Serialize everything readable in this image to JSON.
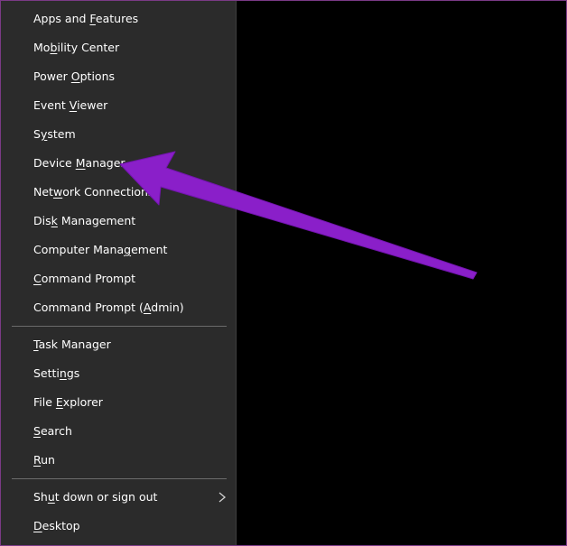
{
  "menu": {
    "group1": [
      {
        "pre": "Apps and ",
        "key": "F",
        "post": "eatures"
      },
      {
        "pre": "Mo",
        "key": "b",
        "post": "ility Center"
      },
      {
        "pre": "Power ",
        "key": "O",
        "post": "ptions"
      },
      {
        "pre": "Event ",
        "key": "V",
        "post": "iewer"
      },
      {
        "pre": "S",
        "key": "y",
        "post": "stem"
      },
      {
        "pre": "Device ",
        "key": "M",
        "post": "anager"
      },
      {
        "pre": "Net",
        "key": "w",
        "post": "ork Connections"
      },
      {
        "pre": "Dis",
        "key": "k",
        "post": " Management"
      },
      {
        "pre": "Computer Mana",
        "key": "g",
        "post": "ement"
      },
      {
        "pre": "",
        "key": "C",
        "post": "ommand Prompt"
      },
      {
        "pre": "Command Prompt (",
        "key": "A",
        "post": "dmin)"
      }
    ],
    "group2": [
      {
        "pre": "",
        "key": "T",
        "post": "ask Manager"
      },
      {
        "pre": "Setti",
        "key": "n",
        "post": "gs"
      },
      {
        "pre": "File ",
        "key": "E",
        "post": "xplorer"
      },
      {
        "pre": "",
        "key": "S",
        "post": "earch"
      },
      {
        "pre": "",
        "key": "R",
        "post": "un"
      }
    ],
    "group3": [
      {
        "pre": "Sh",
        "key": "u",
        "post": "t down or sign out",
        "submenu": true
      },
      {
        "pre": "",
        "key": "D",
        "post": "esktop"
      }
    ]
  },
  "colors": {
    "menu_bg": "#2b2b2b",
    "text": "#ffffff",
    "separator": "#6b6b6b",
    "arrow": "#8a1fc9"
  },
  "icons": {
    "submenu": "chevron-right-icon",
    "annotation": "purple-arrow"
  }
}
